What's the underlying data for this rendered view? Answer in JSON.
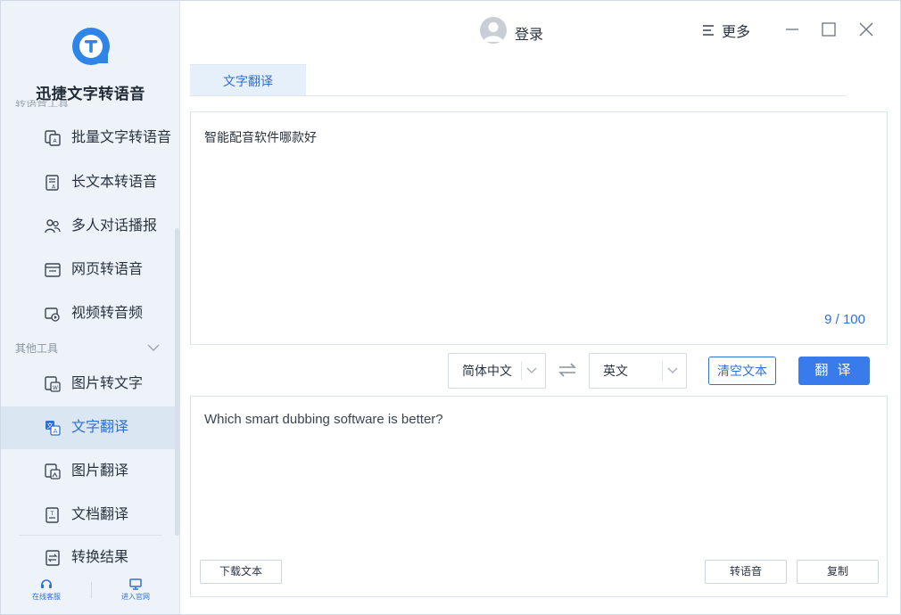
{
  "app": {
    "name": "迅捷文字转语音",
    "cut_section_label": "转语音工具"
  },
  "titlebar": {
    "login": "登录",
    "more": "更多"
  },
  "sidebar": {
    "group1_items": [
      {
        "label": "批量文字转语音",
        "icon": "batch-text-icon"
      },
      {
        "label": "长文本转语音",
        "icon": "long-text-icon"
      },
      {
        "label": "多人对话播报",
        "icon": "multi-person-icon"
      },
      {
        "label": "网页转语音",
        "icon": "webpage-icon"
      },
      {
        "label": "视频转音频",
        "icon": "video-icon"
      }
    ],
    "section_other": "其他工具",
    "group2_items": [
      {
        "label": "图片转文字",
        "icon": "image-to-text-icon"
      },
      {
        "label": "文字翻译",
        "icon": "text-translate-icon",
        "active": true
      },
      {
        "label": "图片翻译",
        "icon": "image-translate-icon"
      },
      {
        "label": "文档翻译",
        "icon": "doc-translate-icon"
      },
      {
        "label": "转换结果",
        "icon": "result-icon"
      }
    ],
    "bottom": {
      "support": "在线客服",
      "website": "进入官网"
    }
  },
  "main": {
    "tab": "文字翻译",
    "input_text": "智能配音软件哪款好",
    "char_count": "9 / 100",
    "source_lang": "简体中文",
    "target_lang": "英文",
    "clear_label": "清空文本",
    "translate_label": "翻 译",
    "output_text": "Which smart dubbing software is better?",
    "download_label": "下载文本",
    "to_speech_label": "转语音",
    "copy_label": "复制"
  },
  "colors": {
    "accent": "#2f6fd6",
    "primary_button": "#3a7bec",
    "sidebar_bg": "#eef3f9",
    "active_item_bg": "#dbe6f3"
  }
}
